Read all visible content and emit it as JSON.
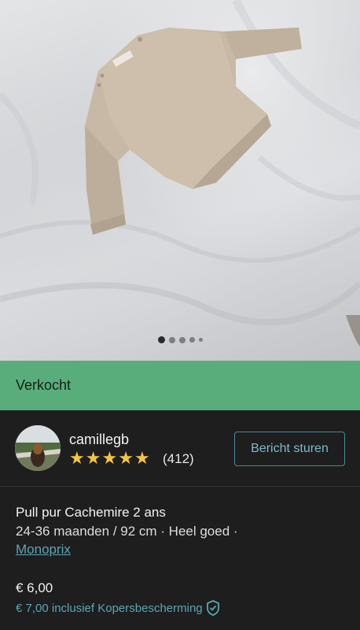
{
  "photo": {
    "carousel": {
      "count": 5,
      "active_index": 0
    }
  },
  "status": {
    "label": "Verkocht",
    "color": "#59ad7a"
  },
  "seller": {
    "username": "camillegb",
    "rating_stars": 5,
    "review_count": "(412)",
    "message_button": "Bericht sturen"
  },
  "item": {
    "title": "Pull pur Cachemire 2 ans",
    "meta": "24-36 maanden / 92 cm · Heel goed ·",
    "brand": "Monoprix",
    "price": "€ 6,00",
    "price_with_protection": "€ 7,00 inclusief Kopersbescherming"
  },
  "icons": {
    "star": "star-icon",
    "shield": "shield-check-icon"
  },
  "colors": {
    "accent": "#5ba6b3",
    "star": "#f4c542",
    "background": "#1e1e1e"
  }
}
